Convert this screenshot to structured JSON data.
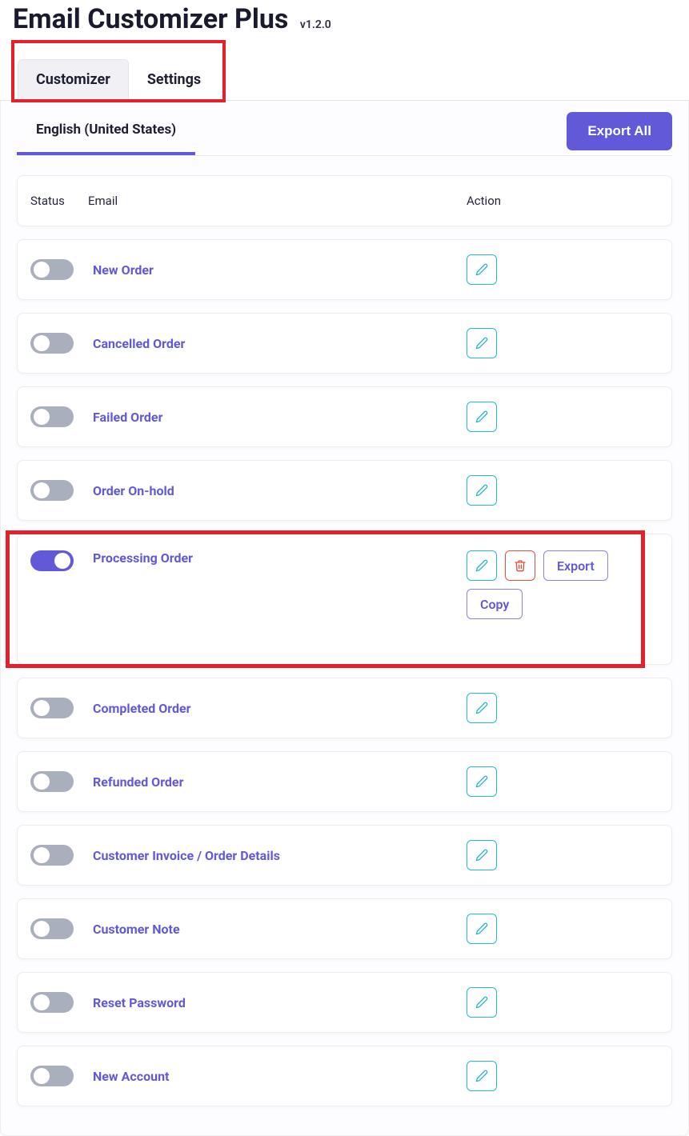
{
  "title": "Email Customizer Plus",
  "version": "v1.2.0",
  "tabs": {
    "customizer": "Customizer",
    "settings": "Settings"
  },
  "language_tab": "English (United States)",
  "export_all": "Export All",
  "columns": {
    "status": "Status",
    "email": "Email",
    "action": "Action"
  },
  "buttons": {
    "export": "Export",
    "copy": "Copy"
  },
  "emails": [
    {
      "name": "New Order",
      "enabled": false,
      "expanded": false
    },
    {
      "name": "Cancelled Order",
      "enabled": false,
      "expanded": false
    },
    {
      "name": "Failed Order",
      "enabled": false,
      "expanded": false
    },
    {
      "name": "Order On-hold",
      "enabled": false,
      "expanded": false
    },
    {
      "name": "Processing Order",
      "enabled": true,
      "expanded": true
    },
    {
      "name": "Completed Order",
      "enabled": false,
      "expanded": false
    },
    {
      "name": "Refunded Order",
      "enabled": false,
      "expanded": false
    },
    {
      "name": "Customer Invoice / Order Details",
      "enabled": false,
      "expanded": false
    },
    {
      "name": "Customer Note",
      "enabled": false,
      "expanded": false
    },
    {
      "name": "Reset Password",
      "enabled": false,
      "expanded": false
    },
    {
      "name": "New Account",
      "enabled": false,
      "expanded": false
    }
  ]
}
